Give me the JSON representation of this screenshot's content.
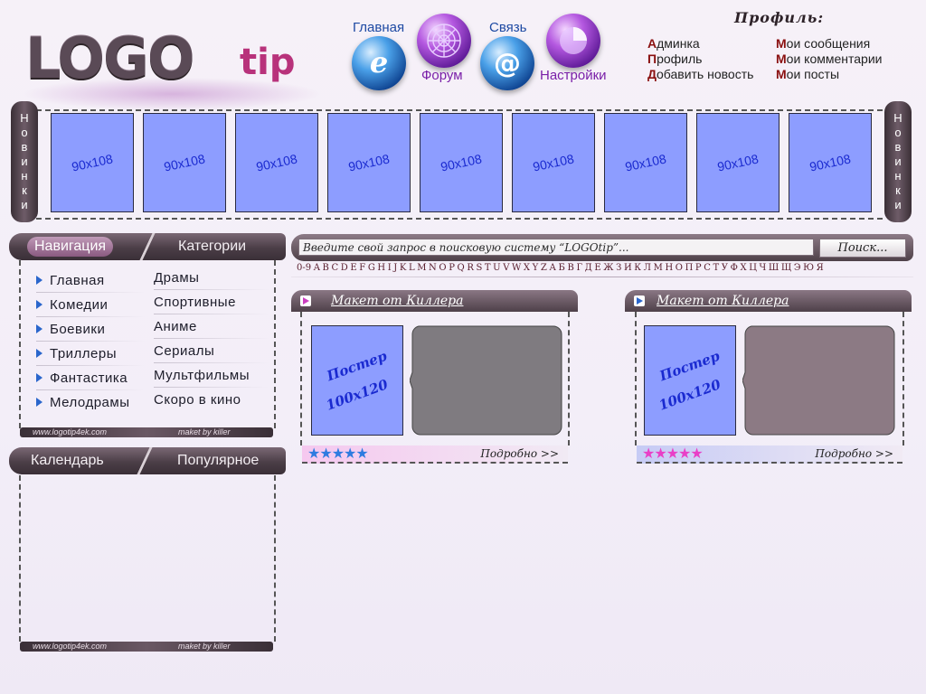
{
  "logo": {
    "main": "LOGO",
    "tip": "tip"
  },
  "topnav": {
    "home": {
      "label": "Главная",
      "icon": "internet-explorer-icon"
    },
    "forum": {
      "label": "Форум",
      "icon": "spider-web-icon"
    },
    "contact": {
      "label": "Связь",
      "icon": "email-at-icon"
    },
    "settings": {
      "label": "Настройки",
      "icon": "settings-orb-icon"
    }
  },
  "profile": {
    "title": "Профиль:",
    "links_left": [
      {
        "first": "А",
        "rest": "дминка"
      },
      {
        "first": "П",
        "rest": "рофиль"
      },
      {
        "first": "Д",
        "rest": "обавить новость"
      }
    ],
    "links_right": [
      {
        "first": "М",
        "rest": "ои сообщения"
      },
      {
        "first": "М",
        "rest": "ои комментарии"
      },
      {
        "first": "М",
        "rest": "ои посты"
      }
    ]
  },
  "new_releases": {
    "label": "Новинки",
    "thumbs": [
      "90x108",
      "90x108",
      "90x108",
      "90x108",
      "90x108",
      "90x108",
      "90x108",
      "90x108",
      "90x108"
    ]
  },
  "nav_block": {
    "tab_active": "Навигация",
    "tab_inactive": "Категории",
    "col1": [
      "Главная",
      "Комедии",
      "Боевики",
      "Триллеры",
      "Фантастика",
      "Мелодрамы"
    ],
    "col2": [
      "Драмы",
      "Спортивные",
      "Аниме",
      "Сериалы",
      "Мультфильмы",
      "Скоро в кино"
    ],
    "footer_left": "www.logotip4ek.com",
    "footer_right": "maket by killer"
  },
  "calendar_block": {
    "tab_active": "Календарь",
    "tab_inactive": "Популярное",
    "footer_left": "www.logotip4ek.com",
    "footer_right": "maket by killer"
  },
  "search": {
    "placeholder": "Введите свой запрос в поисковую систему “LOGOtip”...",
    "button": "Поиск..."
  },
  "alphabet": [
    "0-9",
    "A",
    "B",
    "C",
    "D",
    "E",
    "F",
    "G",
    "H",
    "I",
    "J",
    "K",
    "L",
    "M",
    "N",
    "O",
    "P",
    "Q",
    "R",
    "S",
    "T",
    "U",
    "V",
    "W",
    "X",
    "Y",
    "Z",
    "А",
    "Б",
    "В",
    "Г",
    "Д",
    "Е",
    "Ж",
    "З",
    "И",
    "К",
    "Л",
    "М",
    "Н",
    "О",
    "П",
    "Р",
    "С",
    "Т",
    "У",
    "Ф",
    "Х",
    "Ц",
    "Ч",
    "Ш",
    "Щ",
    "Э",
    "Ю",
    "Я"
  ],
  "cards": [
    {
      "title": "Макет  от  Киллера",
      "poster_line1": "Постер",
      "poster_line2": "100x120",
      "stars": "★★★★★",
      "stars_color": "#2e7be0",
      "more": "Подробно >>",
      "icon_color": "#cc3fc0",
      "footer_bg": "#f5c8ef",
      "desc_color": "#7f7b80"
    },
    {
      "title": "Макет  от  Киллера",
      "poster_line1": "Постер",
      "poster_line2": "100x120",
      "stars": "★★★★★",
      "stars_color": "#e93fc7",
      "more": "Подробно >>",
      "icon_color": "#2a66cc",
      "footer_bg": "#c6cbf5",
      "desc_color": "#8c7a84"
    }
  ]
}
